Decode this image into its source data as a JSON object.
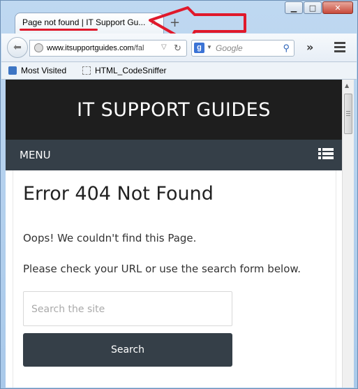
{
  "browser": {
    "tab_title": "Page not found | IT Support Gu...",
    "tab_close": "×",
    "new_tab": "+",
    "url_host": "www.itsupportguides.com",
    "url_rest": "/fal",
    "search_engine_letter": "g",
    "search_placeholder": "Google",
    "overflow": "»",
    "window_controls": {
      "minimize": "▁",
      "maximize": "□",
      "close": "✕"
    }
  },
  "bookmarks": [
    {
      "label": "Most Visited",
      "icon": "bookmark-book-icon"
    },
    {
      "label": "HTML_CodeSniffer",
      "icon": "page-icon"
    }
  ],
  "site": {
    "title": "IT SUPPORT GUIDES",
    "menu_label": "MENU",
    "error_heading": "Error 404 Not Found",
    "paragraph_1": "Oops! We couldn't find this Page.",
    "paragraph_2": "Please check your URL or use the search form below.",
    "search_placeholder": "Search the site",
    "search_button": "Search"
  },
  "annotation": {
    "arrow_color": "#e0192b",
    "underline_color": "#e0192b"
  }
}
